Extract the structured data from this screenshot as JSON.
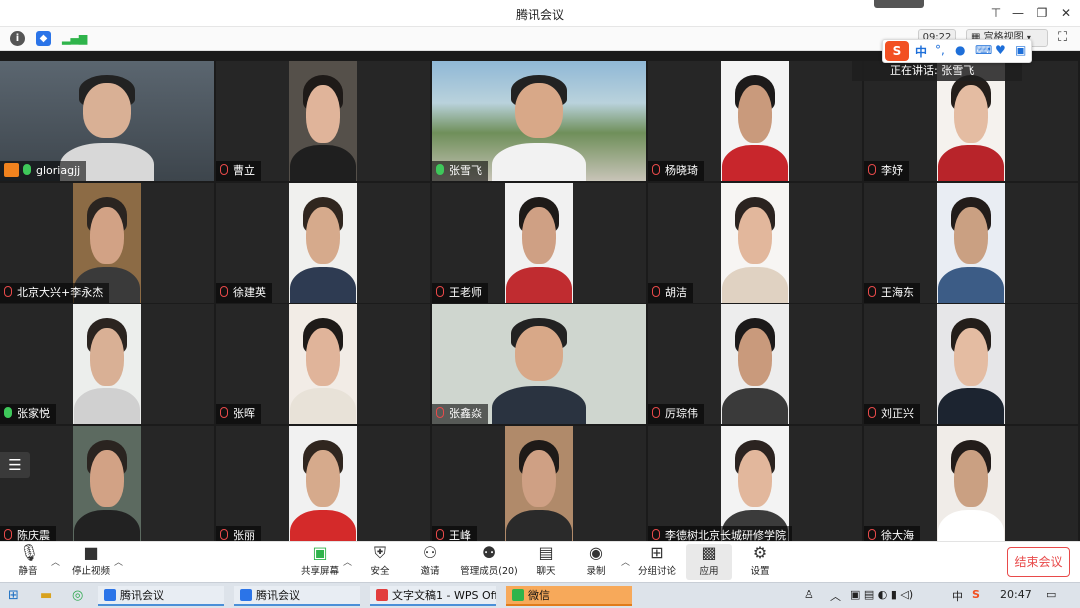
{
  "window": {
    "title": "腾讯会议"
  },
  "status": {
    "time": "09:22",
    "view_mode": "宫格视图"
  },
  "speaker": {
    "prefix": "正在讲话: ",
    "name": "张雪飞"
  },
  "ime": {
    "logo": "S",
    "mode": "中"
  },
  "participants": [
    {
      "name": "gloriagjj",
      "mic": "on",
      "host": true
    },
    {
      "name": "曹立",
      "mic": "off"
    },
    {
      "name": "张雪飞",
      "mic": "on"
    },
    {
      "name": "杨晓琦",
      "mic": "off"
    },
    {
      "name": "李妤",
      "mic": "off"
    },
    {
      "name": "北京大兴+李永杰",
      "mic": "off"
    },
    {
      "name": "徐建英",
      "mic": "off"
    },
    {
      "name": "王老师",
      "mic": "off"
    },
    {
      "name": "胡洁",
      "mic": "off"
    },
    {
      "name": "王海东",
      "mic": "off"
    },
    {
      "name": "张家悦",
      "mic": "on"
    },
    {
      "name": "张晖",
      "mic": "off"
    },
    {
      "name": "张鑫焱",
      "mic": "off"
    },
    {
      "name": "厉琮伟",
      "mic": "off"
    },
    {
      "name": "刘正兴",
      "mic": "off"
    },
    {
      "name": "陈庆震",
      "mic": "off"
    },
    {
      "name": "张丽",
      "mic": "off"
    },
    {
      "name": "王峰",
      "mic": "off"
    },
    {
      "name": "李德树北京长城研修学院",
      "mic": "off"
    },
    {
      "name": "徐大海",
      "mic": "off"
    }
  ],
  "toolbar": {
    "mute": "静音",
    "stop_video": "停止视频",
    "share_screen": "共享屏幕",
    "security": "安全",
    "invite": "邀请",
    "manage_members": "管理成员(20)",
    "chat": "聊天",
    "record": "录制",
    "breakout": "分组讨论",
    "apps": "应用",
    "settings": "设置",
    "end_meeting": "结束会议"
  },
  "taskbar": {
    "items": [
      "腾讯会议",
      "腾讯会议",
      "文字文稿1 - WPS Off...",
      "微信"
    ],
    "clock": "20:47",
    "ime": "中"
  }
}
